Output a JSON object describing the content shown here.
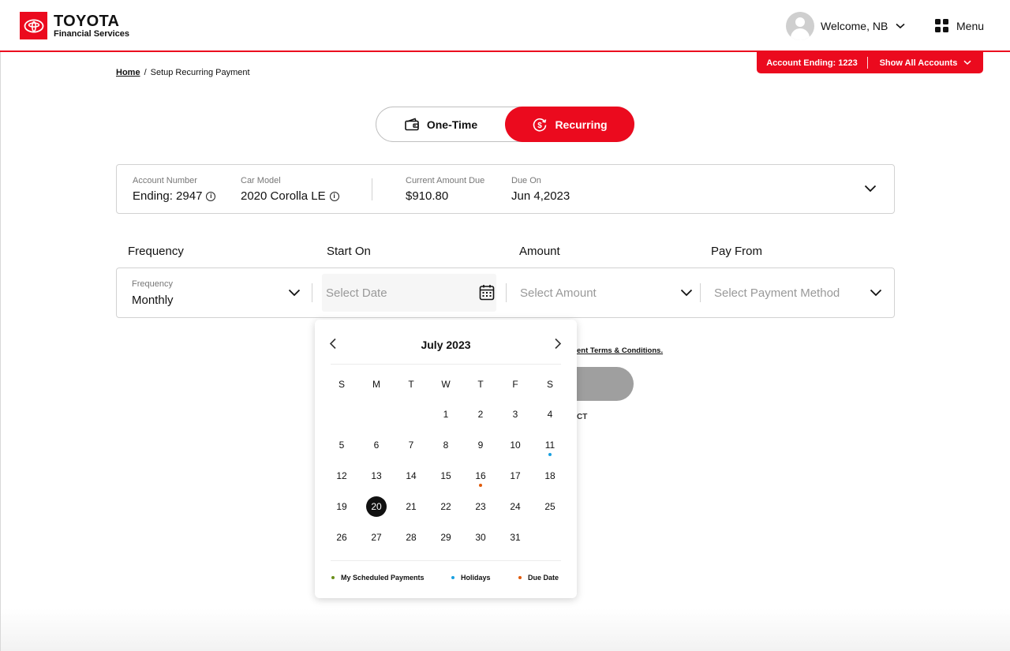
{
  "header": {
    "brand_line1": "TOYOTA",
    "brand_line2": "Financial Services",
    "welcome": "Welcome, NB",
    "menu_label": "Menu",
    "brand_color": "#eb0a1e"
  },
  "account_bar": {
    "account_ending": "Account Ending: 1223",
    "show_all": "Show All Accounts"
  },
  "breadcrumb": {
    "home": "Home",
    "separator": "/",
    "current": "Setup Recurring Payment"
  },
  "payment_toggle": {
    "one_time": "One-Time",
    "recurring": "Recurring",
    "selected": "Recurring"
  },
  "summary": {
    "account_number_label": "Account Number",
    "account_number_value": "Ending: 2947",
    "car_model_label": "Car Model",
    "car_model_value": "2020 Corolla LE",
    "amount_due_label": "Current Amount Due",
    "amount_due_value": "$910.80",
    "due_on_label": "Due On",
    "due_on_value": "Jun 4,2023"
  },
  "form": {
    "frequency_label": "Frequency",
    "start_on_label": "Start On",
    "amount_label": "Amount",
    "pay_from_label": "Pay From",
    "frequency_mini_label": "Frequency",
    "frequency_value": "Monthly",
    "start_placeholder": "Select Date",
    "amount_placeholder": "Select Amount",
    "pay_from_placeholder": "Select Payment Method"
  },
  "behind": {
    "terms_partial": "ent Terms & Conditions.",
    "back_partial": "CT"
  },
  "calendar": {
    "month_title": "July 2023",
    "weekdays": [
      "S",
      "M",
      "T",
      "W",
      "T",
      "F",
      "S"
    ],
    "first_weekday_index": 3,
    "days_in_month": 31,
    "selected_day": 20,
    "holidays": [
      11
    ],
    "due_dates": [
      16
    ],
    "scheduled_payments": [],
    "legend": {
      "scheduled": "My Scheduled Payments",
      "holidays": "Holidays",
      "due_date": "Due Date"
    },
    "colors": {
      "scheduled": "#6a8f1a",
      "holidays": "#1aa0e0",
      "due_date": "#e05a0a"
    }
  }
}
